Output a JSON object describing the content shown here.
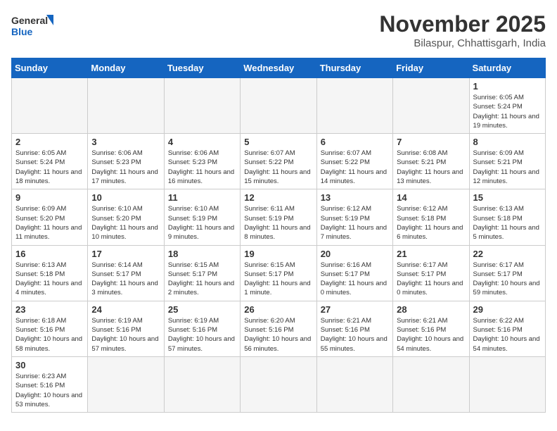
{
  "header": {
    "logo_general": "General",
    "logo_blue": "Blue",
    "month_year": "November 2025",
    "location": "Bilaspur, Chhattisgarh, India"
  },
  "days_of_week": [
    "Sunday",
    "Monday",
    "Tuesday",
    "Wednesday",
    "Thursday",
    "Friday",
    "Saturday"
  ],
  "weeks": [
    [
      {
        "day": "",
        "info": ""
      },
      {
        "day": "",
        "info": ""
      },
      {
        "day": "",
        "info": ""
      },
      {
        "day": "",
        "info": ""
      },
      {
        "day": "",
        "info": ""
      },
      {
        "day": "",
        "info": ""
      },
      {
        "day": "1",
        "info": "Sunrise: 6:05 AM\nSunset: 5:24 PM\nDaylight: 11 hours and 19 minutes."
      }
    ],
    [
      {
        "day": "2",
        "info": "Sunrise: 6:05 AM\nSunset: 5:24 PM\nDaylight: 11 hours and 18 minutes."
      },
      {
        "day": "3",
        "info": "Sunrise: 6:06 AM\nSunset: 5:23 PM\nDaylight: 11 hours and 17 minutes."
      },
      {
        "day": "4",
        "info": "Sunrise: 6:06 AM\nSunset: 5:23 PM\nDaylight: 11 hours and 16 minutes."
      },
      {
        "day": "5",
        "info": "Sunrise: 6:07 AM\nSunset: 5:22 PM\nDaylight: 11 hours and 15 minutes."
      },
      {
        "day": "6",
        "info": "Sunrise: 6:07 AM\nSunset: 5:22 PM\nDaylight: 11 hours and 14 minutes."
      },
      {
        "day": "7",
        "info": "Sunrise: 6:08 AM\nSunset: 5:21 PM\nDaylight: 11 hours and 13 minutes."
      },
      {
        "day": "8",
        "info": "Sunrise: 6:09 AM\nSunset: 5:21 PM\nDaylight: 11 hours and 12 minutes."
      }
    ],
    [
      {
        "day": "9",
        "info": "Sunrise: 6:09 AM\nSunset: 5:20 PM\nDaylight: 11 hours and 11 minutes."
      },
      {
        "day": "10",
        "info": "Sunrise: 6:10 AM\nSunset: 5:20 PM\nDaylight: 11 hours and 10 minutes."
      },
      {
        "day": "11",
        "info": "Sunrise: 6:10 AM\nSunset: 5:19 PM\nDaylight: 11 hours and 9 minutes."
      },
      {
        "day": "12",
        "info": "Sunrise: 6:11 AM\nSunset: 5:19 PM\nDaylight: 11 hours and 8 minutes."
      },
      {
        "day": "13",
        "info": "Sunrise: 6:12 AM\nSunset: 5:19 PM\nDaylight: 11 hours and 7 minutes."
      },
      {
        "day": "14",
        "info": "Sunrise: 6:12 AM\nSunset: 5:18 PM\nDaylight: 11 hours and 6 minutes."
      },
      {
        "day": "15",
        "info": "Sunrise: 6:13 AM\nSunset: 5:18 PM\nDaylight: 11 hours and 5 minutes."
      }
    ],
    [
      {
        "day": "16",
        "info": "Sunrise: 6:13 AM\nSunset: 5:18 PM\nDaylight: 11 hours and 4 minutes."
      },
      {
        "day": "17",
        "info": "Sunrise: 6:14 AM\nSunset: 5:17 PM\nDaylight: 11 hours and 3 minutes."
      },
      {
        "day": "18",
        "info": "Sunrise: 6:15 AM\nSunset: 5:17 PM\nDaylight: 11 hours and 2 minutes."
      },
      {
        "day": "19",
        "info": "Sunrise: 6:15 AM\nSunset: 5:17 PM\nDaylight: 11 hours and 1 minute."
      },
      {
        "day": "20",
        "info": "Sunrise: 6:16 AM\nSunset: 5:17 PM\nDaylight: 11 hours and 0 minutes."
      },
      {
        "day": "21",
        "info": "Sunrise: 6:17 AM\nSunset: 5:17 PM\nDaylight: 11 hours and 0 minutes."
      },
      {
        "day": "22",
        "info": "Sunrise: 6:17 AM\nSunset: 5:17 PM\nDaylight: 10 hours and 59 minutes."
      }
    ],
    [
      {
        "day": "23",
        "info": "Sunrise: 6:18 AM\nSunset: 5:16 PM\nDaylight: 10 hours and 58 minutes."
      },
      {
        "day": "24",
        "info": "Sunrise: 6:19 AM\nSunset: 5:16 PM\nDaylight: 10 hours and 57 minutes."
      },
      {
        "day": "25",
        "info": "Sunrise: 6:19 AM\nSunset: 5:16 PM\nDaylight: 10 hours and 57 minutes."
      },
      {
        "day": "26",
        "info": "Sunrise: 6:20 AM\nSunset: 5:16 PM\nDaylight: 10 hours and 56 minutes."
      },
      {
        "day": "27",
        "info": "Sunrise: 6:21 AM\nSunset: 5:16 PM\nDaylight: 10 hours and 55 minutes."
      },
      {
        "day": "28",
        "info": "Sunrise: 6:21 AM\nSunset: 5:16 PM\nDaylight: 10 hours and 54 minutes."
      },
      {
        "day": "29",
        "info": "Sunrise: 6:22 AM\nSunset: 5:16 PM\nDaylight: 10 hours and 54 minutes."
      }
    ],
    [
      {
        "day": "30",
        "info": "Sunrise: 6:23 AM\nSunset: 5:16 PM\nDaylight: 10 hours and 53 minutes."
      },
      {
        "day": "",
        "info": ""
      },
      {
        "day": "",
        "info": ""
      },
      {
        "day": "",
        "info": ""
      },
      {
        "day": "",
        "info": ""
      },
      {
        "day": "",
        "info": ""
      },
      {
        "day": "",
        "info": ""
      }
    ]
  ]
}
